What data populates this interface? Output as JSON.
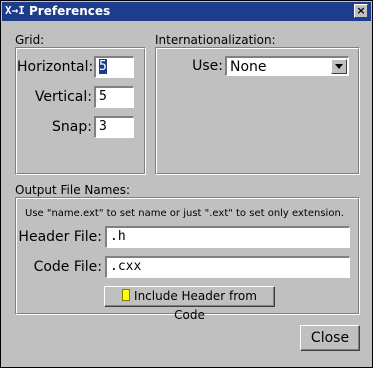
{
  "window": {
    "title": "Preferences",
    "app_glyph": "X→I",
    "close_glyph": "×"
  },
  "grid": {
    "label": "Grid:",
    "horizontal_label": "Horizontal:",
    "horizontal_value": "5",
    "vertical_label": "Vertical:",
    "vertical_value": "5",
    "snap_label": "Snap:",
    "snap_value": "3"
  },
  "i18n": {
    "label": "Internationalization:",
    "use_label": "Use:",
    "use_value": "None"
  },
  "output": {
    "label": "Output File Names:",
    "hint": "Use \"name.ext\" to set name or just \".ext\" to set only extension.",
    "header_label": "Header File:",
    "header_value": ".h",
    "code_label": "Code File:",
    "code_value": ".cxx",
    "include_header_label": "Include Header from Code"
  },
  "actions": {
    "close_label": "Close"
  },
  "colors": {
    "title_bar": "#1e3c8c",
    "background": "#c0c0c0",
    "toggle_light": "#ffff00"
  }
}
